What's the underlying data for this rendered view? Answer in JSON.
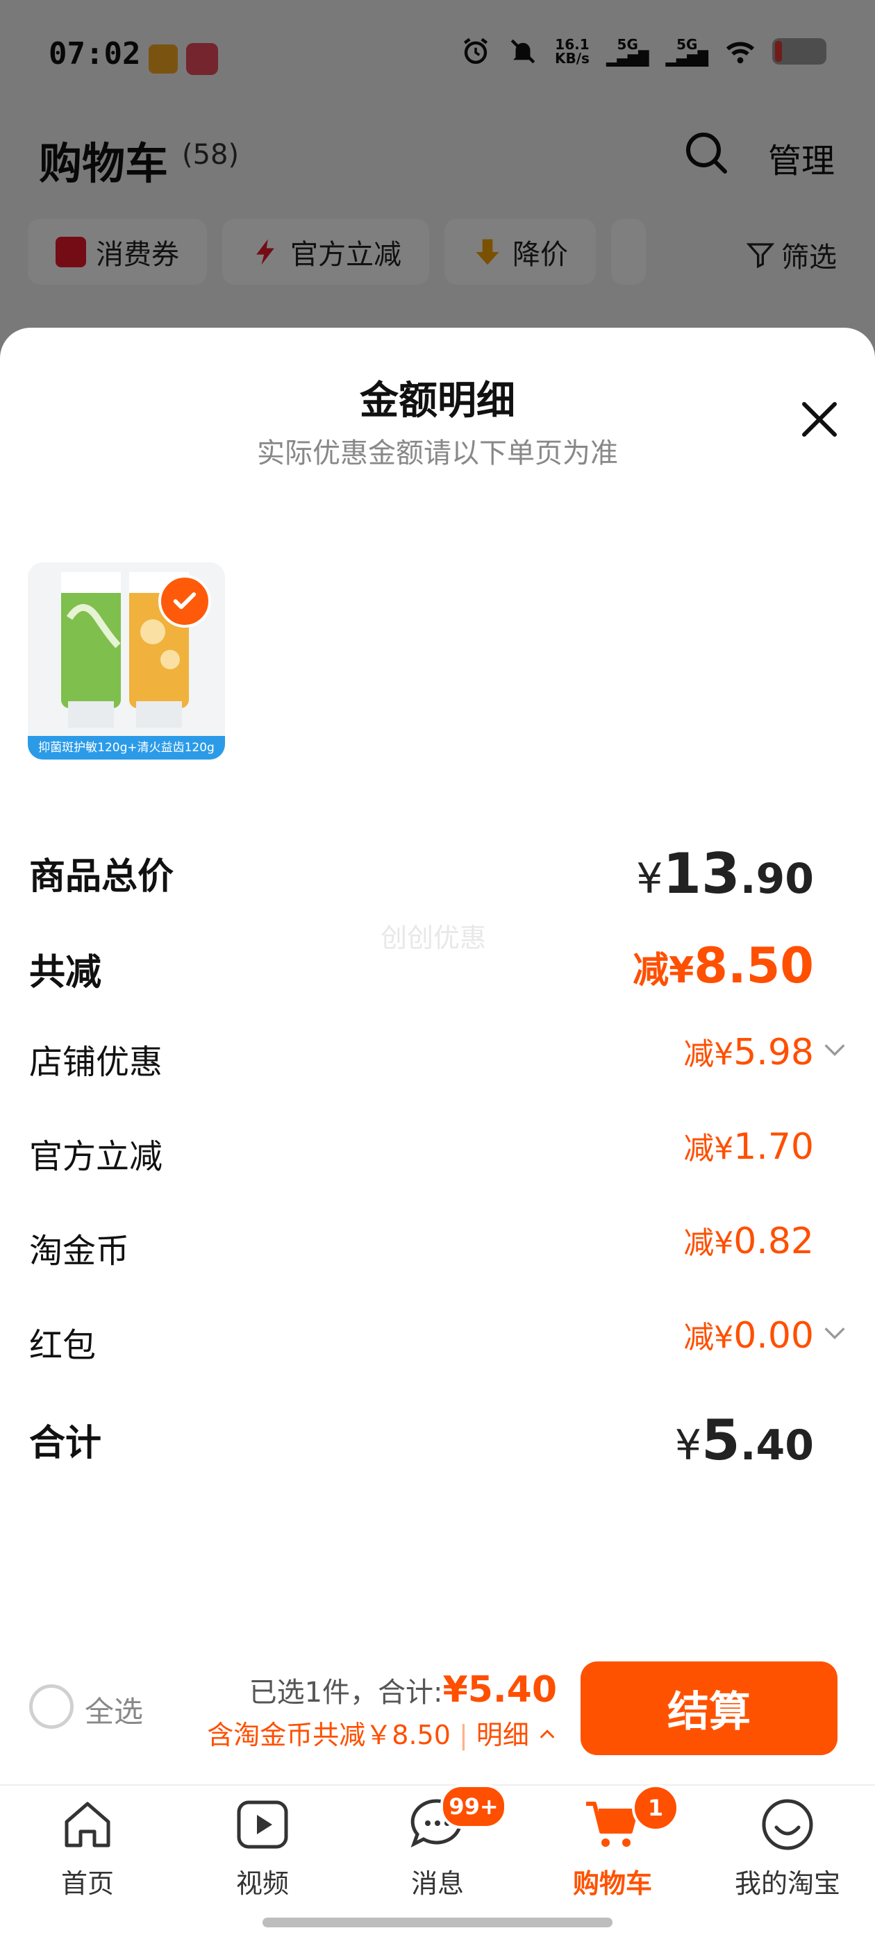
{
  "status_bar": {
    "time": "07:02",
    "net_speed": "16.1",
    "net_unit": "KB/s",
    "sig1": "5G",
    "sig2": "5G"
  },
  "cart": {
    "title": "购物车",
    "count": "(58)",
    "manage": "管理"
  },
  "chips": [
    {
      "label": "消费券",
      "icon": "coupon-icon"
    },
    {
      "label": "官方立减",
      "icon": "lightning-icon"
    },
    {
      "label": "降价",
      "icon": "price-down-icon"
    }
  ],
  "filter_label": "筛选",
  "sheet": {
    "title": "金额明细",
    "subtitle": "实际优惠金额请以下单页为准",
    "thumb_caption": "抑菌斑护敏120g+清火益齿120g",
    "watermark": "创创优惠",
    "rows": {
      "total_price": {
        "label": "商品总价",
        "yen": "¥",
        "int": "13",
        "dec": ".90"
      },
      "total_discount": {
        "label": "共减",
        "prefix": "减¥",
        "int": "8",
        "dec": ".50"
      },
      "shop": {
        "label": "店铺优惠",
        "prefix": "减¥",
        "value": "5.98"
      },
      "official": {
        "label": "官方立减",
        "prefix": "减¥",
        "value": "1.70"
      },
      "coins": {
        "label": "淘金币",
        "prefix": "减¥",
        "value": "0.82"
      },
      "redpacket": {
        "label": "红包",
        "prefix": "减¥",
        "value": "0.00"
      },
      "sum": {
        "label": "合计",
        "yen": "¥",
        "int": "5",
        "dec": ".40"
      }
    }
  },
  "checkout": {
    "select_all": "全选",
    "selected_text": "已选1件，合计:",
    "total": "¥5.40",
    "discount_text": "含淘金币共减￥8.50",
    "detail_link": "明细",
    "pay_button": "结算"
  },
  "tabs": [
    {
      "label": "首页",
      "icon": "home-icon"
    },
    {
      "label": "视频",
      "icon": "video-icon"
    },
    {
      "label": "消息",
      "icon": "message-icon",
      "badge": "99+"
    },
    {
      "label": "购物车",
      "icon": "cart-icon",
      "badge": "1",
      "active": true
    },
    {
      "label": "我的淘宝",
      "icon": "profile-icon"
    }
  ],
  "colors": {
    "accent": "#ff5200",
    "discount": "#ff4f00"
  }
}
